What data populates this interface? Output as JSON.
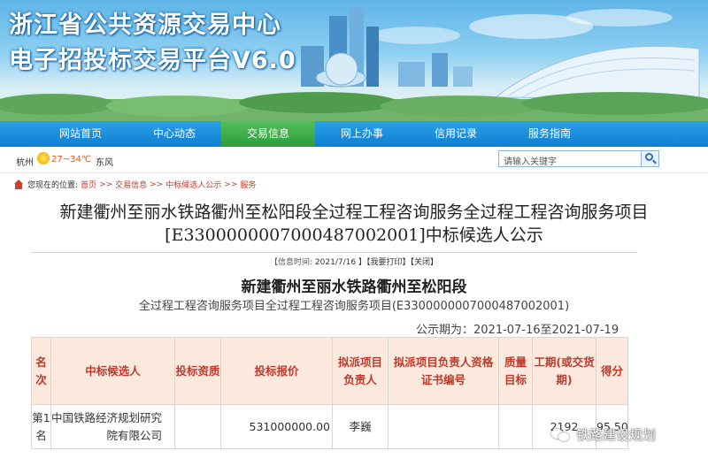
{
  "banner": {
    "title_line1": "浙江省公共资源交易中心",
    "title_line2": "电子招投标交易平台V6.0"
  },
  "nav": {
    "items": [
      {
        "label": "网站首页"
      },
      {
        "label": "中心动态"
      },
      {
        "label": "交易信息",
        "active": true
      },
      {
        "label": "网上办事"
      },
      {
        "label": "信用记录"
      },
      {
        "label": "服务指南"
      }
    ],
    "active_color": "#2f9b3a",
    "bar_color": "#0f7ed2"
  },
  "weather": {
    "city": "杭州",
    "icon": "sun-icon",
    "temperature": "27~34℃",
    "wind": "东风"
  },
  "search": {
    "placeholder": "请输入关键字",
    "icon": "search-icon"
  },
  "breadcrumb": {
    "prefix": "您现在的位置:",
    "items": [
      "首页",
      "交易信息",
      "中标候选人公示",
      "服务"
    ],
    "separator": ">>"
  },
  "article": {
    "title_line1": "新建衢州至丽水铁路衢州至松阳段全过程工程咨询服务全过程工程咨询服务项目",
    "title_line2": "[E3300000007000487002001]中标候选人公示",
    "meta": {
      "date_label": "【信息时间:",
      "date_value": "2021/7/16",
      "print_label": "】【我要打印】",
      "close_label": "【关闭】"
    },
    "subtitle": "新建衢州至丽水铁路衢州至松阳段",
    "subtitle2": "全过程工程咨询服务项目全过程工程咨询服务项目(E3300000007000487002001)",
    "period": "公示期为：2021-07-16至2021-07-19"
  },
  "table": {
    "headers": [
      "名次",
      "中标候选人",
      "投标资质",
      "投标报价",
      "拟派项目负责人",
      "拟派项目负责人资格证书编号",
      "质量目标",
      "工期(或交货期)",
      "得分"
    ],
    "rows": [
      {
        "rank": "第1名",
        "candidate": "中国铁路经济规划研究院有限公司",
        "qualification": "",
        "price": "531000000.00",
        "manager": "李巍",
        "cert_no": "",
        "quality": "",
        "duration": "2192",
        "score": "95.50"
      }
    ],
    "header_bg": "#fbe9dd",
    "header_color": "#c0392b"
  },
  "watermark": {
    "text": "铁路建设规划",
    "icon": "wechat-icon"
  }
}
